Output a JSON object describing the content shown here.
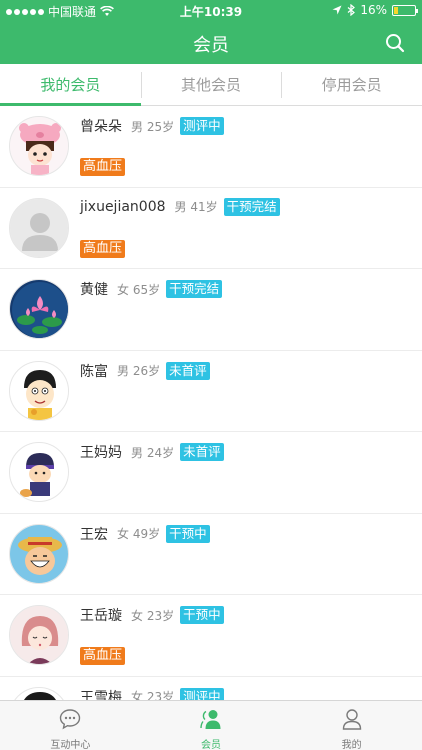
{
  "status_bar": {
    "carrier": "中国联通",
    "time": "上午10:39",
    "battery": "16%",
    "battery_level": 0.16
  },
  "nav": {
    "title": "会员",
    "search_icon": "search-icon"
  },
  "tabs": [
    {
      "label": "我的会员",
      "active": true
    },
    {
      "label": "其他会员",
      "active": false
    },
    {
      "label": "停用会员",
      "active": false
    }
  ],
  "members": [
    {
      "name": "曾朵朵",
      "meta": "男 25岁",
      "badge": "测评中",
      "tag": "高血压",
      "avatar": "pig-hat-girl"
    },
    {
      "name": "jixuejian008",
      "meta": "男 41岁",
      "badge": "干预完结",
      "tag": "高血压",
      "avatar": "default-person"
    },
    {
      "name": "黄健",
      "meta": "女 65岁",
      "badge": "干预完结",
      "tag": "",
      "avatar": "lotus"
    },
    {
      "name": "陈富",
      "meta": "男 26岁",
      "badge": "未首评",
      "tag": "",
      "avatar": "cartoon-boy"
    },
    {
      "name": "王妈妈",
      "meta": "男 24岁",
      "badge": "未首评",
      "tag": "",
      "avatar": "ninja-boy"
    },
    {
      "name": "王宏",
      "meta": "女 49岁",
      "badge": "干预中",
      "tag": "",
      "avatar": "straw-hat"
    },
    {
      "name": "王岳璇",
      "meta": "女 23岁",
      "badge": "干预中",
      "tag": "高血压",
      "avatar": "pink-hair-girl"
    },
    {
      "name": "王雪梅",
      "meta": "女 23岁",
      "badge": "测评中",
      "tag": "",
      "avatar": "dark-hair-girl"
    }
  ],
  "tab_bar": [
    {
      "label": "互动中心",
      "icon": "chat-bubble-icon",
      "active": false
    },
    {
      "label": "会员",
      "icon": "members-icon",
      "active": true
    },
    {
      "label": "我的",
      "icon": "profile-icon",
      "active": false
    }
  ],
  "colors": {
    "brand_green": "#3dba6c",
    "badge_blue": "#2ec2e3",
    "tag_orange": "#f07b1b"
  }
}
